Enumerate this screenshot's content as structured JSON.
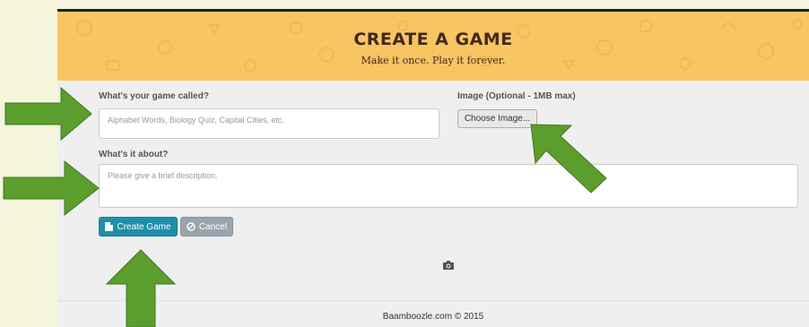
{
  "header": {
    "title": "CREATE A GAME",
    "subtitle": "Make it once. Play it forever."
  },
  "form": {
    "name_label": "What's your game called?",
    "name_placeholder": "Alphabet Words, Biology Quiz, Capital Cities, etc.",
    "image_label": "Image (Optional - 1MB max)",
    "choose_image_label": "Choose Image...",
    "about_label": "What's it about?",
    "about_placeholder": "Please give a brief description."
  },
  "actions": {
    "create_label": "Create Game",
    "cancel_label": "Cancel"
  },
  "footer": {
    "copyright": "Baamboozle.com © 2015"
  },
  "icons": {
    "create": "document-icon",
    "cancel": "ban-icon",
    "camera": "camera-icon",
    "arrows": "arrow-icon"
  },
  "colors": {
    "header_bg": "#f9c462",
    "header_text": "#3f2a1c",
    "create_button": "#1f8fa8",
    "cancel_button": "#9aa4ac",
    "arrow": "#5b9e2d",
    "page_side": "#f5f5dc"
  }
}
